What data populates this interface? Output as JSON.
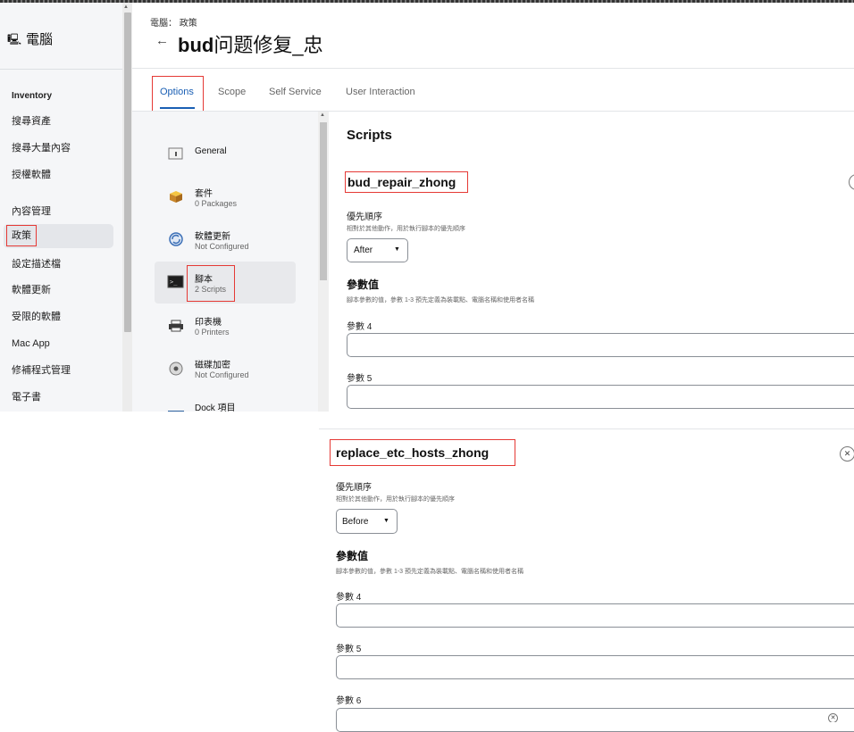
{
  "header": {
    "breadcrumb": "電腦： 政策",
    "title_bold": "bud",
    "title_rest": "问题修复_忠"
  },
  "sidebar": {
    "title": "電腦",
    "items": [
      "Inventory",
      "搜尋資產",
      "搜尋大量內容",
      "授權軟體",
      "內容管理",
      "政策",
      "設定描述檔",
      "軟體更新",
      "受限的軟體",
      "Mac App",
      "修補程式管理",
      "電子書"
    ],
    "active": "政策"
  },
  "tabs": [
    "Options",
    "Scope",
    "Self Service",
    "User Interaction"
  ],
  "nav": [
    {
      "title": "General",
      "sub": "",
      "icon": "general-icon"
    },
    {
      "title": "套件",
      "sub": "0 Packages",
      "icon": "package-icon"
    },
    {
      "title": "軟體更新",
      "sub": "Not Configured",
      "icon": "software-update-icon"
    },
    {
      "title": "腳本",
      "sub": "2 Scripts",
      "icon": "terminal-icon"
    },
    {
      "title": "印表機",
      "sub": "0 Printers",
      "icon": "printer-icon"
    },
    {
      "title": "磁碟加密",
      "sub": "Not Configured",
      "icon": "disk-encryption-icon"
    },
    {
      "title": "Dock 項目",
      "sub": "",
      "icon": "dock-icon"
    }
  ],
  "content": {
    "heading": "Scripts",
    "scripts": [
      {
        "name": "bud_repair_zhong",
        "priority_label": "優先順序",
        "priority_hint": "相對於其他動作，用於執行腳本的優先順序",
        "priority_value": "After",
        "params_heading": "參數值",
        "params_hint": "腳本參數的值，參數 1-3 預先定義為裝載點、電腦名稱和使用者名稱",
        "param_labels": [
          "參數 4",
          "參數 5"
        ]
      },
      {
        "name": "replace_etc_hosts_zhong",
        "priority_label": "優先順序",
        "priority_hint": "相對於其他動作，用於執行腳本的優先順序",
        "priority_value": "Before",
        "params_heading": "參數值",
        "params_hint": "腳本參數的值，參數 1-3 預先定義為裝載點、電腦名稱和使用者名稱",
        "param_labels": [
          "參數 4",
          "參數 5",
          "參數 6"
        ]
      }
    ]
  },
  "colors": {
    "accent": "#1a5fb4",
    "highlight_box": "#e53935",
    "sidebar_bg": "#f5f6f8"
  }
}
